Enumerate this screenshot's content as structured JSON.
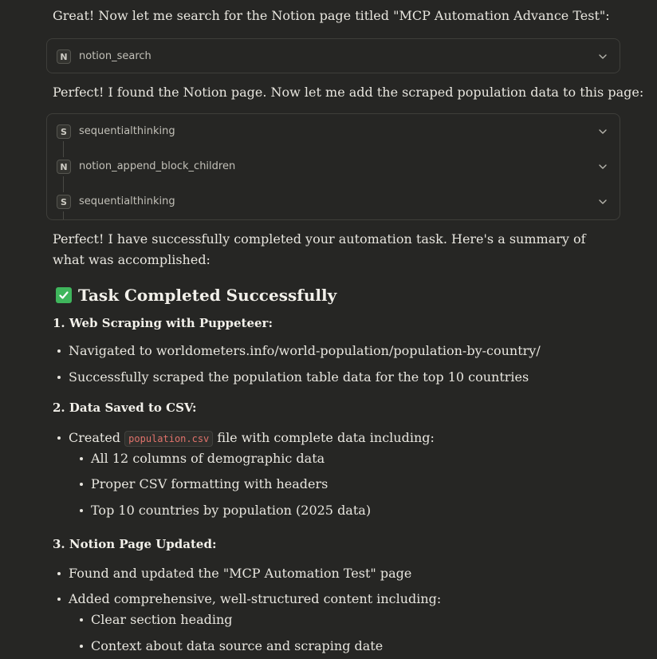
{
  "intro_search": "Great! Now let me search for the Notion page titled \"MCP Automation Advance Test\":",
  "tool_search": {
    "badge": "N",
    "name": "notion_search"
  },
  "found_text": "Perfect! I found the Notion page. Now let me add the scraped population data to this page:",
  "tool_group": [
    {
      "badge": "S",
      "name": "sequentialthinking"
    },
    {
      "badge": "N",
      "name": "notion_append_block_children"
    },
    {
      "badge": "S",
      "name": "sequentialthinking"
    }
  ],
  "summary_intro": "Perfect! I have successfully completed your automation task. Here's a summary of what was accomplished:",
  "summary_heading": "Task Completed Successfully",
  "section1": {
    "title": "1. Web Scraping with Puppeteer:",
    "items": [
      "Navigated to worldometers.info/world-population/population-by-country/",
      "Successfully scraped the population table data for the top 10 countries"
    ]
  },
  "section2": {
    "title": "2. Data Saved to CSV:",
    "created_prefix": "Created",
    "file_name": "population.csv",
    "created_suffix": "file with complete data including:",
    "sub_items": [
      "All 12 columns of demographic data",
      "Proper CSV formatting with headers",
      "Top 10 countries by population (2025 data)"
    ]
  },
  "section3": {
    "title": "3. Notion Page Updated:",
    "items": [
      "Found and updated the \"MCP Automation Test\" page",
      "Added comprehensive, well-structured content including:"
    ],
    "sub_items": [
      "Clear section heading",
      "Context about data source and scraping date"
    ]
  }
}
